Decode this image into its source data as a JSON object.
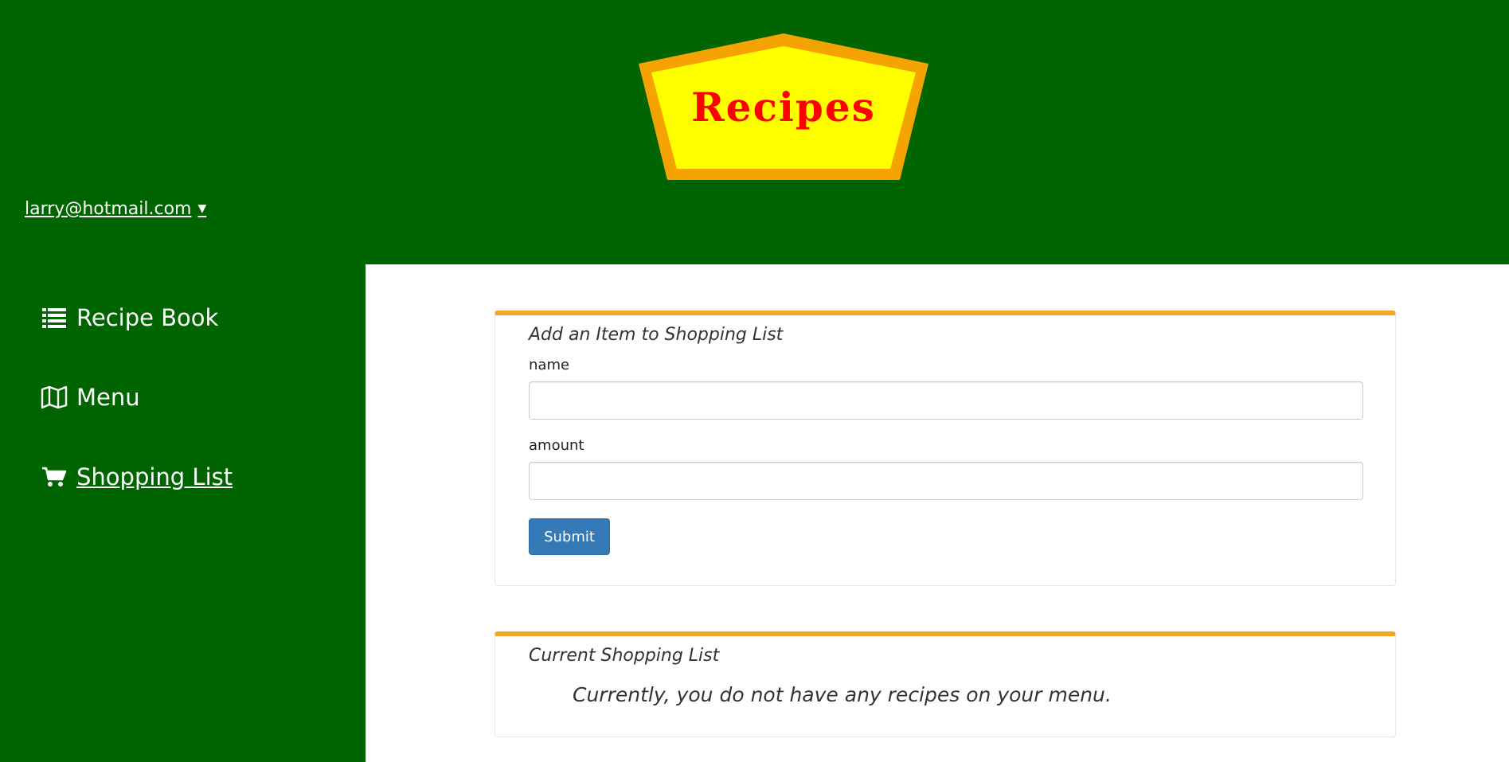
{
  "logo": {
    "text": "Recipes",
    "colors": {
      "outer": "#f5a300",
      "inner": "#ffff00",
      "text": "#ff0000"
    }
  },
  "user": {
    "email": "larry@hotmail.com",
    "caret": "▼"
  },
  "sidebar": {
    "items": [
      {
        "label": "Recipe Book",
        "icon": "list-icon",
        "active": false
      },
      {
        "label": "Menu",
        "icon": "map-icon",
        "active": false
      },
      {
        "label": "Shopping List",
        "icon": "cart-icon",
        "active": true
      }
    ]
  },
  "add_form": {
    "title": "Add an Item to Shopping List",
    "name_label": "name",
    "name_value": "",
    "amount_label": "amount",
    "amount_value": "",
    "submit_label": "Submit"
  },
  "current_list": {
    "title": "Current Shopping List",
    "empty_message": "Currently, you do not have any recipes on your menu."
  },
  "colors": {
    "background": "#006400",
    "accent": "#f5a623",
    "button": "#337ab7"
  }
}
